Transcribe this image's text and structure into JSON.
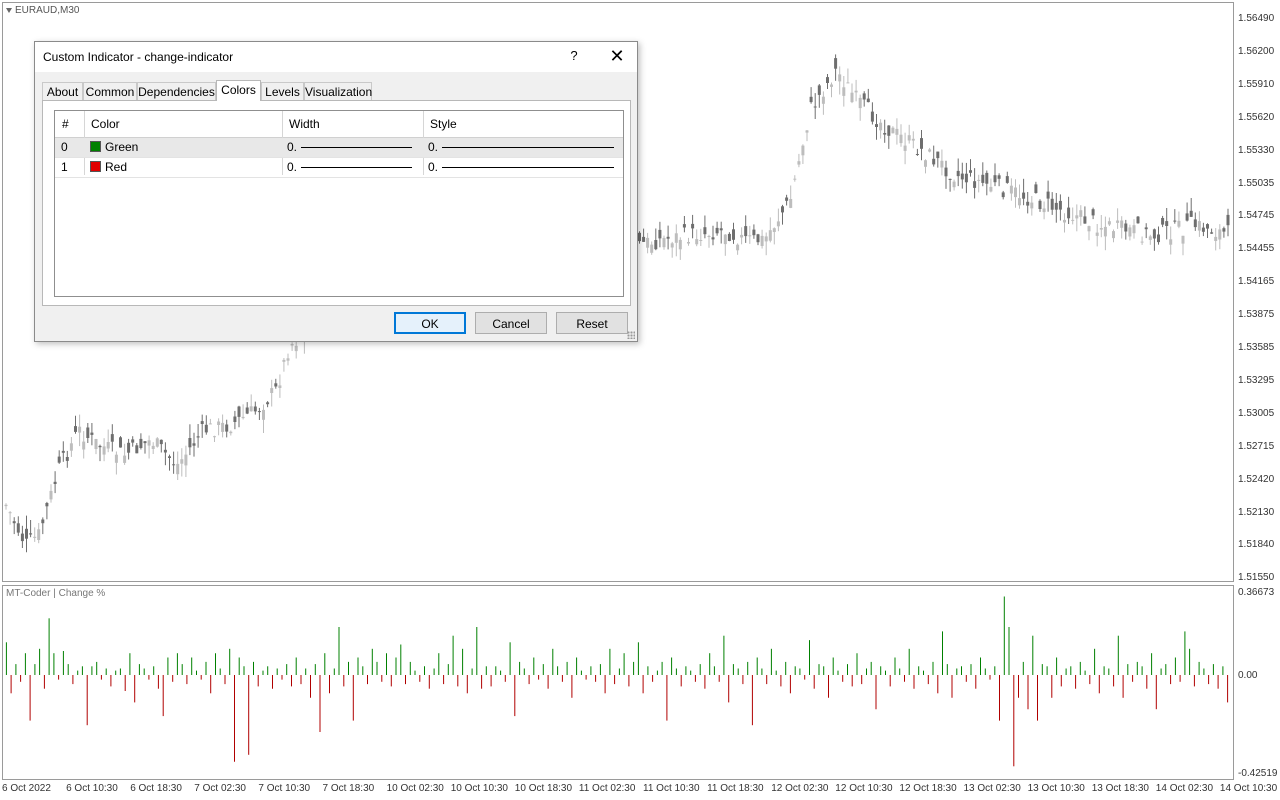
{
  "chart": {
    "symbol_label": "EURAUD,M30",
    "indicator_label": "MT-Coder | Change %",
    "price_ticks": [
      "1.56490",
      "1.56200",
      "1.55910",
      "1.55620",
      "1.55330",
      "1.55035",
      "1.54745",
      "1.54455",
      "1.54165",
      "1.53875",
      "1.53585",
      "1.53295",
      "1.53005",
      "1.52715",
      "1.52420",
      "1.52130",
      "1.51840",
      "1.51550"
    ],
    "indicator_ticks": [
      "0.36673",
      "0.00",
      "-0.42519"
    ],
    "time_ticks": [
      "6 Oct 2022",
      "6 Oct 10:30",
      "6 Oct 18:30",
      "7 Oct 02:30",
      "7 Oct 10:30",
      "7 Oct 18:30",
      "10 Oct 02:30",
      "10 Oct 10:30",
      "10 Oct 18:30",
      "11 Oct 02:30",
      "11 Oct 10:30",
      "11 Oct 18:30",
      "12 Oct 02:30",
      "12 Oct 10:30",
      "12 Oct 18:30",
      "13 Oct 02:30",
      "13 Oct 10:30",
      "13 Oct 18:30",
      "14 Oct 02:30",
      "14 Oct 10:30"
    ],
    "colors": {
      "up": "#008000",
      "down": "#b00000",
      "candle": "#bdbdbd",
      "candle_dark": "#6e6e6e"
    }
  },
  "chart_data": {
    "type": "bar",
    "series": [
      {
        "name": "Change %",
        "note_positive_color": "Green",
        "note_negative_color": "Red"
      }
    ],
    "ylim": [
      -0.42519,
      0.36673
    ],
    "values": [
      0.15,
      -0.08,
      0.05,
      -0.03,
      0.1,
      -0.2,
      0.05,
      0.12,
      -0.06,
      0.26,
      0.1,
      -0.02,
      0.11,
      0.05,
      -0.04,
      0.02,
      0.04,
      -0.22,
      0.04,
      0.06,
      -0.02,
      0.03,
      -0.05,
      0.02,
      0.03,
      -0.07,
      0.1,
      -0.12,
      0.05,
      0.03,
      -0.02,
      0.04,
      -0.06,
      -0.18,
      0.08,
      -0.03,
      0.1,
      0.05,
      -0.04,
      0.08,
      0.02,
      -0.02,
      0.06,
      -0.08,
      0.1,
      0.03,
      -0.04,
      0.12,
      -0.38,
      0.08,
      0.04,
      -0.35,
      0.06,
      -0.05,
      0.02,
      0.04,
      -0.06,
      0.03,
      -0.02,
      0.05,
      -0.05,
      0.08,
      -0.04,
      0.03,
      -0.1,
      0.05,
      -0.25,
      0.1,
      -0.08,
      0.03,
      0.22,
      -0.05,
      0.06,
      -0.2,
      0.08,
      0.04,
      -0.04,
      0.12,
      0.06,
      -0.03,
      0.1,
      -0.05,
      0.08,
      0.14,
      -0.04,
      0.06,
      0.02,
      -0.03,
      0.04,
      -0.06,
      0.03,
      0.1,
      -0.04,
      0.05,
      0.18,
      -0.05,
      0.12,
      -0.08,
      0.03,
      0.22,
      -0.06,
      0.04,
      -0.05,
      0.04,
      0.02,
      -0.03,
      0.15,
      -0.18,
      0.06,
      0.03,
      -0.04,
      0.08,
      -0.02,
      0.05,
      -0.06,
      0.12,
      0.04,
      -0.03,
      0.06,
      -0.1,
      0.08,
      0.02,
      -0.02,
      0.04,
      -0.03,
      0.05,
      -0.08,
      0.12,
      -0.04,
      0.03,
      0.1,
      -0.05,
      0.06,
      0.15,
      -0.08,
      0.04,
      -0.03,
      0.02,
      0.06,
      -0.2,
      0.08,
      0.03,
      -0.05,
      0.04,
      0.02,
      -0.03,
      0.05,
      -0.06,
      0.1,
      0.04,
      -0.03,
      0.18,
      -0.12,
      0.05,
      0.03,
      -0.04,
      0.06,
      -0.22,
      0.08,
      0.03,
      -0.04,
      0.12,
      0.02,
      -0.05,
      0.06,
      -0.08,
      0.04,
      0.03,
      -0.02,
      0.16,
      -0.06,
      0.05,
      0.04,
      -0.1,
      0.08,
      0.02,
      -0.03,
      0.05,
      -0.05,
      0.1,
      -0.04,
      0.03,
      0.06,
      -0.15,
      0.04,
      0.02,
      -0.05,
      0.08,
      0.03,
      -0.03,
      0.12,
      -0.06,
      0.04,
      0.02,
      -0.04,
      0.06,
      -0.08,
      0.2,
      0.05,
      -0.1,
      0.03,
      0.04,
      -0.03,
      0.05,
      -0.06,
      0.08,
      0.03,
      -0.02,
      0.04,
      -0.2,
      0.36,
      0.22,
      -0.4,
      -0.1,
      0.06,
      -0.15,
      0.18,
      -0.2,
      0.05,
      0.04,
      -0.1,
      0.08,
      -0.05,
      0.03,
      0.04,
      -0.06,
      0.06,
      0.02,
      -0.04,
      0.12,
      -0.08,
      0.04,
      0.03,
      -0.05,
      0.18,
      -0.1,
      0.05,
      -0.03,
      0.06,
      0.04,
      -0.06,
      0.1,
      -0.15,
      0.03,
      0.05,
      -0.04,
      0.08,
      -0.03,
      0.2,
      0.12,
      -0.05,
      0.06,
      0.03,
      -0.04,
      0.05,
      -0.06,
      0.04,
      -0.12
    ]
  },
  "dialog": {
    "title": "Custom Indicator - change-indicator",
    "help": "?",
    "close": "✕",
    "tabs": [
      "About",
      "Common",
      "Dependencies",
      "Colors",
      "Levels",
      "Visualization"
    ],
    "active_tab": "Colors",
    "table": {
      "headers": [
        "#",
        "Color",
        "Width",
        "Style"
      ],
      "rows": [
        {
          "index": "0",
          "color_name": "Green",
          "color_hex": "#008000",
          "width": "0.",
          "style": "0."
        },
        {
          "index": "1",
          "color_name": "Red",
          "color_hex": "#e00000",
          "width": "0.",
          "style": "0."
        }
      ]
    },
    "buttons": {
      "ok": "OK",
      "cancel": "Cancel",
      "reset": "Reset"
    }
  }
}
